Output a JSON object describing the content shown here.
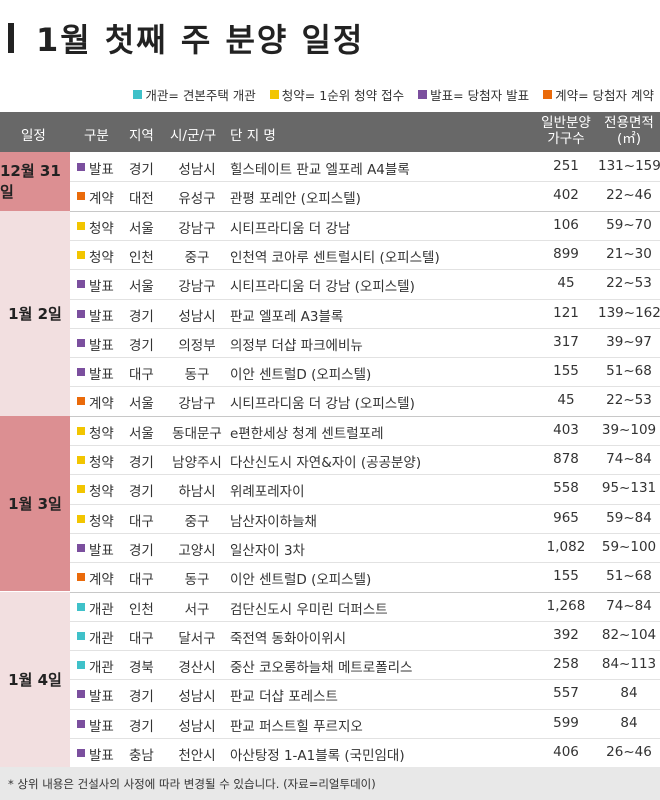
{
  "title": "1월 첫째 주 분양 일정",
  "legend": [
    {
      "color": "#3fc1c9",
      "label": "개관= 견본주택 개관"
    },
    {
      "color": "#f2c500",
      "label": "청약= 1순위 청약 접수"
    },
    {
      "color": "#7b4f9e",
      "label": "발표= 당첨자 발표"
    },
    {
      "color": "#ea6a0a",
      "label": "계약= 당첨자 계약"
    }
  ],
  "headers": {
    "date": "일정",
    "type": "구분",
    "region": "지역",
    "district": "시/군/구",
    "complex": "단   지   명",
    "units_line1": "일반분양",
    "units_line2": "가구수",
    "area_line1": "전용면적",
    "area_line2": "(㎡)"
  },
  "colors": {
    "개관": "#3fc1c9",
    "청약": "#f2c500",
    "발표": "#7b4f9e",
    "계약": "#ea6a0a"
  },
  "groups": [
    {
      "date": "12월 31일",
      "bg": "#dc8f92",
      "rows": [
        {
          "type": "발표",
          "region": "경기",
          "district": "성남시",
          "complex": "힐스테이트 판교 엘포레 A4블록",
          "units": "251",
          "area": "131~159"
        },
        {
          "type": "계약",
          "region": "대전",
          "district": "유성구",
          "complex": "관평 포레안 (오피스텔)",
          "units": "402",
          "area": "22~46"
        }
      ]
    },
    {
      "date": "1월 2일",
      "bg": "#f2dfe0",
      "rows": [
        {
          "type": "청약",
          "region": "서울",
          "district": "강남구",
          "complex": "시티프라디움 더 강남",
          "units": "106",
          "area": "59~70"
        },
        {
          "type": "청약",
          "region": "인천",
          "district": "중구",
          "complex": "인천역 코아루 센트럴시티 (오피스텔)",
          "units": "899",
          "area": "21~30"
        },
        {
          "type": "발표",
          "region": "서울",
          "district": "강남구",
          "complex": "시티프라디움 더 강남 (오피스텔)",
          "units": "45",
          "area": "22~53"
        },
        {
          "type": "발표",
          "region": "경기",
          "district": "성남시",
          "complex": "판교 엘포레 A3블록",
          "units": "121",
          "area": "139~162"
        },
        {
          "type": "발표",
          "region": "경기",
          "district": "의정부",
          "complex": "의정부 더샵 파크에비뉴",
          "units": "317",
          "area": "39~97"
        },
        {
          "type": "발표",
          "region": "대구",
          "district": "동구",
          "complex": "이안 센트럴D (오피스텔)",
          "units": "155",
          "area": "51~68"
        },
        {
          "type": "계약",
          "region": "서울",
          "district": "강남구",
          "complex": "시티프라디움 더 강남 (오피스텔)",
          "units": "45",
          "area": "22~53"
        }
      ]
    },
    {
      "date": "1월 3일",
      "bg": "#dc8f92",
      "rows": [
        {
          "type": "청약",
          "region": "서울",
          "district": "동대문구",
          "complex": "e편한세상 청계 센트럴포레",
          "units": "403",
          "area": "39~109"
        },
        {
          "type": "청약",
          "region": "경기",
          "district": "남양주시",
          "complex": "다산신도시 자연&자이 (공공분양)",
          "units": "878",
          "area": "74~84"
        },
        {
          "type": "청약",
          "region": "경기",
          "district": "하남시",
          "complex": "위례포레자이",
          "units": "558",
          "area": "95~131"
        },
        {
          "type": "청약",
          "region": "대구",
          "district": "중구",
          "complex": "남산자이하늘채",
          "units": "965",
          "area": "59~84"
        },
        {
          "type": "발표",
          "region": "경기",
          "district": "고양시",
          "complex": "일산자이 3차",
          "units": "1,082",
          "area": "59~100"
        },
        {
          "type": "계약",
          "region": "대구",
          "district": "동구",
          "complex": "이안 센트럴D (오피스텔)",
          "units": "155",
          "area": "51~68"
        }
      ]
    },
    {
      "date": "1월 4일",
      "bg": "#f2dfe0",
      "rows": [
        {
          "type": "개관",
          "region": "인천",
          "district": "서구",
          "complex": "검단신도시 우미린 더퍼스트",
          "units": "1,268",
          "area": "74~84"
        },
        {
          "type": "개관",
          "region": "대구",
          "district": "달서구",
          "complex": "죽전역 동화아이위시",
          "units": "392",
          "area": "82~104"
        },
        {
          "type": "개관",
          "region": "경북",
          "district": "경산시",
          "complex": "중산 코오롱하늘채 메트로폴리스",
          "units": "258",
          "area": "84~113"
        },
        {
          "type": "발표",
          "region": "경기",
          "district": "성남시",
          "complex": "판교 더샵 포레스트",
          "units": "557",
          "area": "84"
        },
        {
          "type": "발표",
          "region": "경기",
          "district": "성남시",
          "complex": "판교 퍼스트힐 푸르지오",
          "units": "599",
          "area": "84"
        },
        {
          "type": "발표",
          "region": "충남",
          "district": "천안시",
          "complex": "아산탕정 1-A1블록 (국민임대)",
          "units": "406",
          "area": "26~46"
        }
      ]
    }
  ],
  "footer": "* 상위 내용은 건설사의 사정에 따라 변경될 수 있습니다. (자료=리얼투데이)"
}
